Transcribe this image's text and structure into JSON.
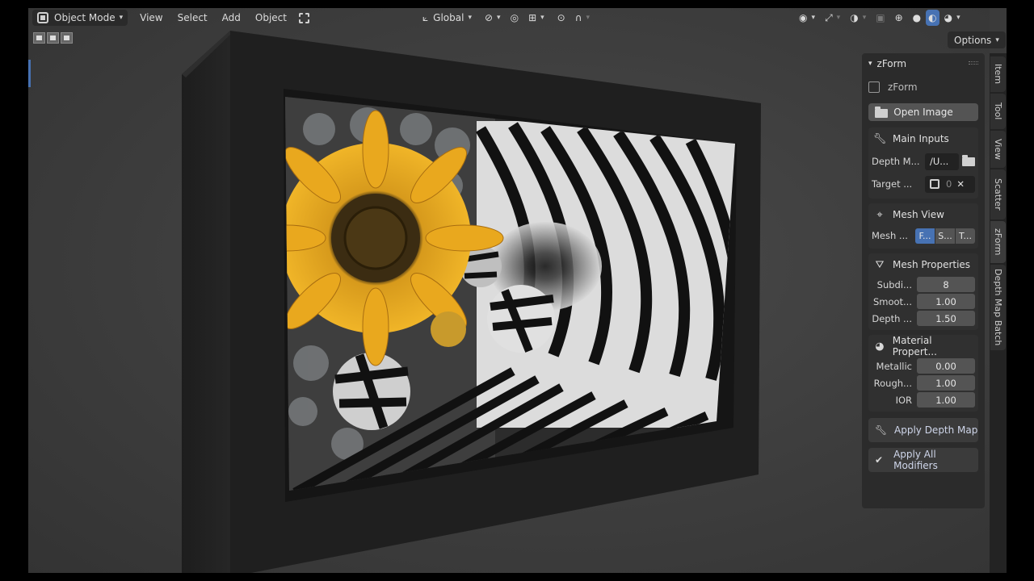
{
  "header": {
    "mode_label": "Object Mode",
    "menus": [
      "View",
      "Select",
      "Add",
      "Object"
    ],
    "orientation_label": "Global",
    "options_label": "Options"
  },
  "npanel": {
    "panel_title": "zForm",
    "enable_label": "zForm",
    "open_image_label": "Open Image",
    "main_inputs": {
      "title": "Main Inputs",
      "depth_map_label": "Depth M...",
      "depth_map_value": "/U...",
      "target_label": "Target ...",
      "target_value": "0"
    },
    "mesh_view": {
      "title": "Mesh View",
      "label": "Mesh ...",
      "options": [
        "F...",
        "S...",
        "T..."
      ],
      "active_index": 0
    },
    "mesh_properties": {
      "title": "Mesh Properties",
      "rows": [
        {
          "label": "Subdi...",
          "value": "8"
        },
        {
          "label": "Smoot...",
          "value": "1.00"
        },
        {
          "label": "Depth ...",
          "value": "1.50"
        }
      ]
    },
    "material_properties": {
      "title": "Material Propert...",
      "rows": [
        {
          "label": "Metallic",
          "value": "0.00"
        },
        {
          "label": "Rough...",
          "value": "1.00"
        },
        {
          "label": "IOR",
          "value": "1.00"
        }
      ]
    },
    "apply_depth_label": "Apply Depth Map",
    "apply_all_label": "Apply All Modifiers"
  },
  "tabs": [
    "Item",
    "Tool",
    "View",
    "Scatter",
    "zForm",
    "Depth Map Batch"
  ],
  "colors": {
    "accent": "#4772b3",
    "viewport": "#3d3d3d",
    "panel": "#2b2b2b"
  }
}
